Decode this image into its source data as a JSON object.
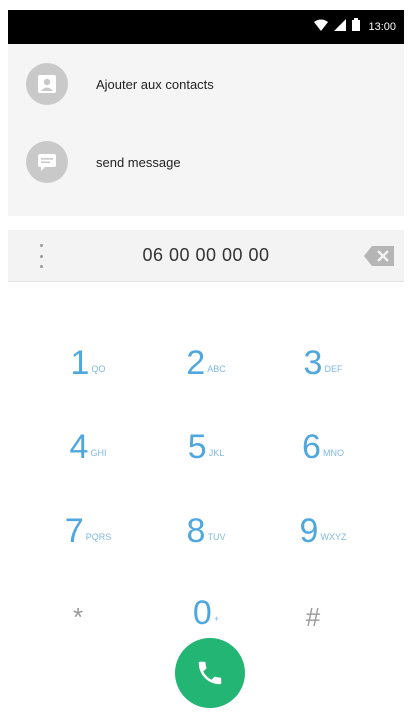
{
  "status_bar": {
    "time": "13:00"
  },
  "suggestions": [
    {
      "label": "Ajouter aux contacts",
      "icon": "person-icon"
    },
    {
      "label": "send message",
      "icon": "message-icon"
    }
  ],
  "dial": {
    "number": "06 00 00 00 00"
  },
  "keypad": {
    "keys": [
      {
        "digit": "1",
        "letters": "QO"
      },
      {
        "digit": "2",
        "letters": "ABC"
      },
      {
        "digit": "3",
        "letters": "DEF"
      },
      {
        "digit": "4",
        "letters": "GHI"
      },
      {
        "digit": "5",
        "letters": "JKL"
      },
      {
        "digit": "6",
        "letters": "MNO"
      },
      {
        "digit": "7",
        "letters": "PQRS"
      },
      {
        "digit": "8",
        "letters": "TUV"
      },
      {
        "digit": "9",
        "letters": "WXYZ"
      },
      {
        "digit": "*",
        "letters": ""
      },
      {
        "digit": "0",
        "letters": "+"
      },
      {
        "digit": "#",
        "letters": ""
      }
    ]
  },
  "colors": {
    "accent": "#4fa7e0",
    "call": "#22b573"
  }
}
